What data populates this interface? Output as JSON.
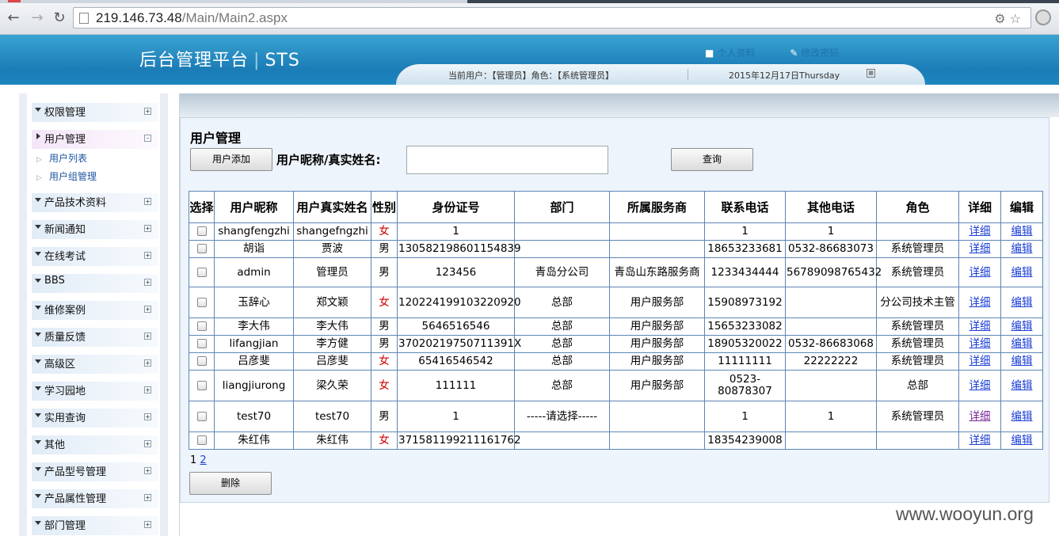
{
  "browser": {
    "url_host": "219.146.73.48",
    "url_path": "/Main/Main2.aspx"
  },
  "header": {
    "title": "后台管理平台",
    "title_suffix": "STS",
    "link_personal": "个人资料",
    "link_password": "修改密码",
    "current_user": "当前用户：【管理员】角色：【系统管理员】",
    "date": "2015年12月17日Thursday"
  },
  "sidebar": {
    "items": [
      {
        "label": "权限管理"
      },
      {
        "label": "用户管理"
      },
      {
        "label": "产品技术资料"
      },
      {
        "label": "新闻通知"
      },
      {
        "label": "在线考试"
      },
      {
        "label": "BBS"
      },
      {
        "label": "维修案例"
      },
      {
        "label": "质量反馈"
      },
      {
        "label": "高级区"
      },
      {
        "label": "学习园地"
      },
      {
        "label": "实用查询"
      },
      {
        "label": "其他"
      },
      {
        "label": "产品型号管理"
      },
      {
        "label": "产品属性管理"
      },
      {
        "label": "部门管理"
      }
    ],
    "subitems": [
      {
        "label": "用户列表"
      },
      {
        "label": "用户组管理"
      }
    ]
  },
  "main": {
    "title": "用户管理",
    "add_button": "用户添加",
    "search_label": "用户昵称/真实姓名:",
    "search_value": "",
    "query_button": "查询",
    "delete_button": "删除",
    "pager_current": "1",
    "pager_next": "2"
  },
  "table": {
    "headers": [
      "选择",
      "用户昵称",
      "用户真实姓名",
      "性别",
      "身份证号",
      "部门",
      "所属服务商",
      "联系电话",
      "其他电话",
      "角色",
      "详细",
      "编辑"
    ],
    "detail_link": "详细",
    "edit_link": "编辑",
    "rows": [
      {
        "nick": "shangfengzhi",
        "real": "shangefngzhi",
        "gender": "女",
        "id": "1",
        "dept": "",
        "provider": "",
        "phone": "1",
        "other": "1",
        "role": ""
      },
      {
        "nick": "胡诣",
        "real": "贾波",
        "gender": "男",
        "id": "130582198601154839",
        "dept": "",
        "provider": "",
        "phone": "18653233681",
        "other": "0532-86683073",
        "role": "系统管理员"
      },
      {
        "nick": "admin",
        "real": "管理员",
        "gender": "男",
        "id": "123456",
        "dept": "青岛分公司",
        "provider": "青岛山东路服务商",
        "phone": "1233434444",
        "other": "56789098765432",
        "role": "系统管理员"
      },
      {
        "nick": "玉辞心",
        "real": "郑文颖",
        "gender": "女",
        "id": "120224199103220920",
        "dept": "总部",
        "provider": "用户服务部",
        "phone": "15908973192",
        "other": "",
        "role": "分公司技术主管"
      },
      {
        "nick": "李大伟",
        "real": "李大伟",
        "gender": "男",
        "id": "5646516546",
        "dept": "总部",
        "provider": "用户服务部",
        "phone": "15653233082",
        "other": "",
        "role": "系统管理员"
      },
      {
        "nick": "lifangjian",
        "real": "李方健",
        "gender": "男",
        "id": "37020219750711391X",
        "dept": "总部",
        "provider": "用户服务部",
        "phone": "18905320022",
        "other": "0532-86683068",
        "role": "系统管理员"
      },
      {
        "nick": "吕彦斐",
        "real": "吕彦斐",
        "gender": "女",
        "id": "65416546542",
        "dept": "总部",
        "provider": "用户服务部",
        "phone": "11111111",
        "other": "22222222",
        "role": "系统管理员"
      },
      {
        "nick": "liangjiurong",
        "real": "梁久荣",
        "gender": "女",
        "id": "111111",
        "dept": "总部",
        "provider": "用户服务部",
        "phone": "0523-80878307",
        "other": "",
        "role": "总部"
      },
      {
        "nick": "test70",
        "real": "test70",
        "gender": "男",
        "id": "1",
        "dept": "-----请选择-----",
        "provider": "",
        "phone": "1",
        "other": "1",
        "role": "系统管理员"
      },
      {
        "nick": "朱红伟",
        "real": "朱红伟",
        "gender": "女",
        "id": "371581199211161762",
        "dept": "",
        "provider": "",
        "phone": "18354239008",
        "other": "",
        "role": ""
      }
    ]
  },
  "watermark": "www.wooyun.org",
  "colors": {
    "header_blue": "#1b7cb6",
    "female_red": "#d00000",
    "link_blue": "#1b3fd8",
    "grid_border": "#5b86b6"
  }
}
